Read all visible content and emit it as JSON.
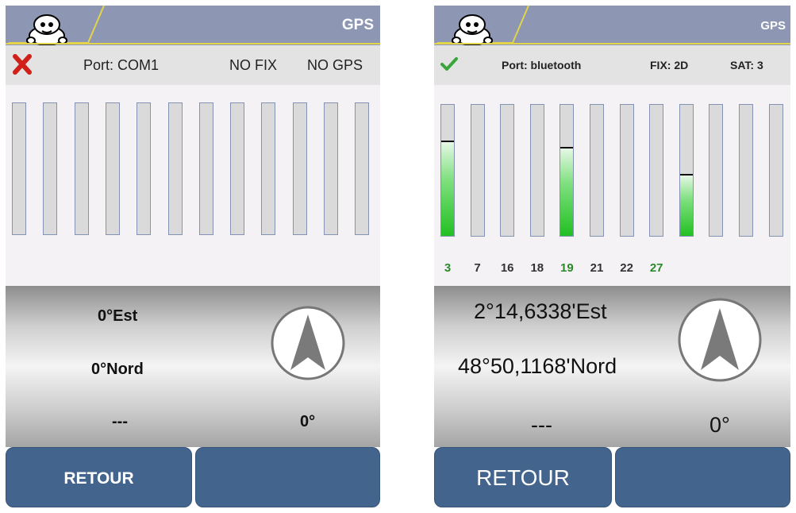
{
  "screens": [
    {
      "header": {
        "title": "GPS",
        "logo_icon": "michelin-bibendum-logo"
      },
      "status": {
        "icon": "error-x-icon",
        "icon_color": "#d0201a",
        "port": "Port: COM1",
        "fix": "NO FIX",
        "sat": "NO GPS"
      },
      "satellites": {
        "bar_count": 12,
        "signal_levels": [
          0,
          0,
          0,
          0,
          0,
          0,
          0,
          0,
          0,
          0,
          0,
          0
        ],
        "labels": []
      },
      "position": {
        "longitude": "0°Est",
        "latitude": "0°Nord",
        "altitude": "---",
        "heading": "0°"
      },
      "buttons": {
        "back_label": "RETOUR",
        "second_label": ""
      }
    },
    {
      "header": {
        "title": "GPS",
        "logo_icon": "michelin-bibendum-logo"
      },
      "status": {
        "icon": "checkmark-icon",
        "icon_color": "#3aa53a",
        "port": "Port: bluetooth",
        "fix": "FIX: 2D",
        "sat": "SAT: 3"
      },
      "satellites": {
        "bar_count": 12,
        "signal_levels": [
          0.73,
          0,
          0,
          0,
          0.68,
          0,
          0,
          0,
          0.47,
          0,
          0,
          0
        ],
        "labels": [
          {
            "id": "3",
            "active": true
          },
          {
            "id": "7",
            "active": false
          },
          {
            "id": "16",
            "active": false
          },
          {
            "id": "18",
            "active": false
          },
          {
            "id": "19",
            "active": true
          },
          {
            "id": "21",
            "active": false
          },
          {
            "id": "22",
            "active": false
          },
          {
            "id": "27",
            "active": true
          }
        ]
      },
      "position": {
        "longitude": "2°14,6338'Est",
        "latitude": "48°50,1168'Nord",
        "altitude": "---",
        "heading": "0°"
      },
      "buttons": {
        "back_label": "RETOUR",
        "second_label": ""
      }
    }
  ],
  "colors": {
    "header_bg": "#8d96b2",
    "header_accent": "#e3d44a",
    "button_bg": "#42648d",
    "signal_green": "#22c022"
  }
}
